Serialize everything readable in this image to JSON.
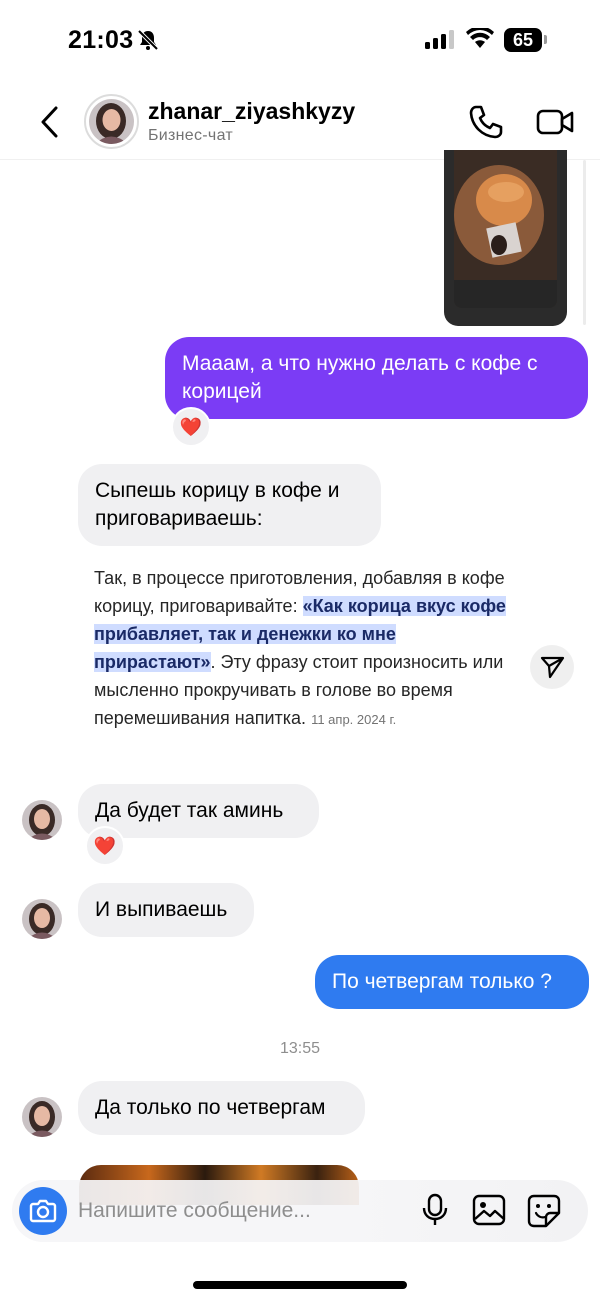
{
  "status_bar": {
    "time": "21:03",
    "battery": "65"
  },
  "header": {
    "username": "zhanar_ziyashkyzy",
    "subtitle": "Бизнес-чат",
    "back_icon": "chevron-left-icon",
    "call_icon": "phone-icon",
    "video_icon": "video-camera-icon"
  },
  "messages": [
    {
      "id": "m1",
      "direction": "outgoing",
      "text": "Мааам, а что нужно делать с кофе с корицей",
      "reaction": "❤️"
    },
    {
      "id": "m2",
      "direction": "incoming",
      "text": "Сыпешь корицу в кофе и приговариваешь:",
      "quote": {
        "intro": "Так, в процессе приготовления, добавляя в кофе корицу, приговаривайте: ",
        "highlight": "«Как корица вкус кофе прибавляет, так и денежки ко мне прирастают»",
        "rest": ". Эту фразу стоит произносить или мысленно прокручивать в голове во время перемешивания напитка.",
        "date": "11 апр. 2024 г."
      }
    },
    {
      "id": "m3",
      "direction": "incoming",
      "text": "Да будет так аминь",
      "reaction": "❤️"
    },
    {
      "id": "m4",
      "direction": "incoming",
      "text": "И выпиваешь"
    },
    {
      "id": "m5",
      "direction": "outgoing",
      "text": "По четвергам только ?"
    },
    {
      "id": "m6",
      "direction": "incoming",
      "text": "Да только по четвергам"
    }
  ],
  "time_separator": "13:55",
  "composer": {
    "placeholder": "Напишите сообщение..."
  },
  "colors": {
    "outgoing_purple": "#7b3cf5",
    "outgoing_blue": "#2f7bf0",
    "incoming_bg": "#f0f0f2",
    "highlight_bg": "#cfdcff"
  }
}
